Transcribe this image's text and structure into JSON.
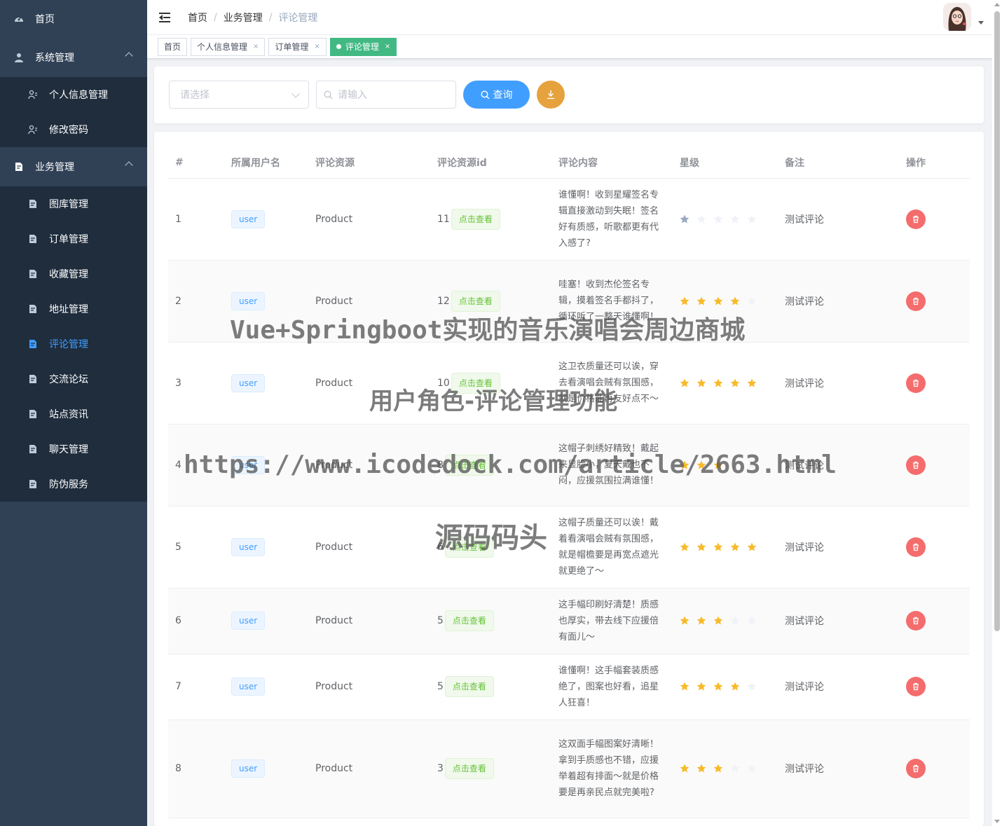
{
  "sidebar": {
    "home": "首页",
    "system": {
      "label": "系统管理",
      "items": [
        "个人信息管理",
        "修改密码"
      ]
    },
    "business": {
      "label": "业务管理",
      "items": [
        "图库管理",
        "订单管理",
        "收藏管理",
        "地址管理",
        "评论管理",
        "交流论坛",
        "站点资讯",
        "聊天管理",
        "防伪服务"
      ],
      "active": "评论管理"
    }
  },
  "breadcrumb": [
    "首页",
    "业务管理",
    "评论管理"
  ],
  "tags": [
    {
      "label": "首页",
      "closable": false
    },
    {
      "label": "个人信息管理",
      "closable": true
    },
    {
      "label": "订单管理",
      "closable": true
    },
    {
      "label": "评论管理",
      "closable": true,
      "active": true
    }
  ],
  "tag_close": "×",
  "search": {
    "select_placeholder": "请选择",
    "input_placeholder": "请输入",
    "query_label": "查询"
  },
  "table": {
    "headers": [
      "#",
      "所属用户名",
      "评论资源",
      "评论资源id",
      "评论内容",
      "星级",
      "备注",
      "操作"
    ],
    "view_label": "点击查看",
    "rows": [
      {
        "index": "1",
        "user": "user",
        "resource": "Product",
        "resource_id": "11",
        "content": "谁懂啊！收到星耀签名专辑直接激动到失眠！签名好有质感，听歌都更有代入感了?",
        "stars": 1,
        "remark": "测试评论"
      },
      {
        "index": "2",
        "user": "user",
        "resource": "Product",
        "resource_id": "12",
        "content": "哇塞！收到杰伦签名专辑，摸着签名手都抖了，循环听了一整天谁懂啊！",
        "stars": 4,
        "remark": "测试评论"
      },
      {
        "index": "3",
        "user": "user",
        "resource": "Product",
        "resource_id": "10",
        "content": "这卫衣质量还可以诶，穿去看演唱会贼有氛围感，就是价格能再友好点不～",
        "stars": 5,
        "remark": "测试评论"
      },
      {
        "index": "4",
        "user": "user",
        "resource": "Product",
        "resource_id": "8",
        "content": "这帽子刺绣好精致！戴起来显脸小，夏天戴也不闷，应援氛围拉满谁懂！",
        "stars": 3,
        "remark": "测试评论"
      },
      {
        "index": "5",
        "user": "user",
        "resource": "Product",
        "resource_id": "6",
        "content": "这帽子质量还可以诶！戴着看演唱会贼有氛围感，就是帽檐要是再宽点遮光就更绝了～",
        "stars": 5,
        "remark": "测试评论"
      },
      {
        "index": "6",
        "user": "user",
        "resource": "Product",
        "resource_id": "5",
        "content": "这手幅印刷好清楚！质感也厚实，带去线下应援倍有面儿～",
        "stars": 3,
        "remark": "测试评论"
      },
      {
        "index": "7",
        "user": "user",
        "resource": "Product",
        "resource_id": "5",
        "content": "谁懂啊！这手幅套装质感绝了，图案也好看，追星人狂喜！",
        "stars": 4,
        "remark": "测试评论"
      },
      {
        "index": "8",
        "user": "user",
        "resource": "Product",
        "resource_id": "3",
        "content": "这双面手幅图案好清晰！拿到手质感也不错，应援举着超有排面～就是价格要是再亲民点就完美啦?",
        "stars": 3,
        "remark": "测试评论"
      }
    ]
  },
  "watermarks": {
    "line1": "Vue+Springboot实现的音乐演唱会周边商城",
    "line2": "用户角色-评论管理功能",
    "line3": "https://www.icodedock.com/article/2663.html",
    "line4": "源码码头"
  },
  "colors": {
    "sidebar_bg": "#304156",
    "submenu_bg": "#1f2d3d",
    "primary": "#409eff",
    "success": "#42b983",
    "warning": "#e6a23c",
    "danger": "#f56c6c",
    "star_on": "#f7ba2a",
    "star_off": "#eff2f7"
  }
}
